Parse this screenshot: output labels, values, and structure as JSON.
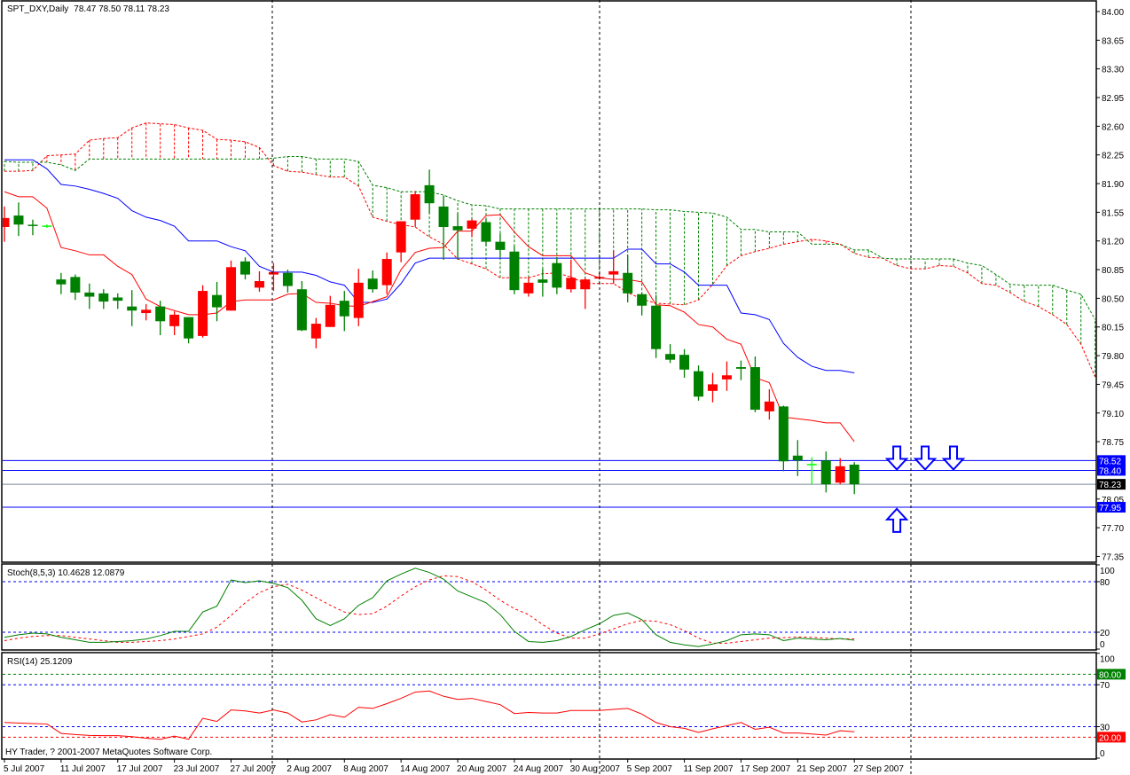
{
  "header": {
    "title": "SPT_DXY,Daily",
    "ohlc": "78.47 78.50 78.11 78.23"
  },
  "footer": {
    "copyright": "HY Trader, ? 2001-2007 MetaQuotes Software Corp."
  },
  "colors": {
    "up": "#ff0000",
    "down": "#008000",
    "doji": "#00ff00",
    "tenkan": "#ff0000",
    "kijun": "#0000ff",
    "span_a": "#ff0000",
    "span_b": "#008000",
    "level": "#0000ff",
    "bid": "#778899",
    "stoch_main": "#008000",
    "stoch_signal": "#ff0000",
    "rsi": "#ff0000"
  },
  "chart_data": [
    {
      "type": "candlestick",
      "title": "SPT_DXY,Daily",
      "ylim": [
        77.28,
        84.14
      ],
      "price_ticks": [
        "84.00",
        "83.65",
        "83.30",
        "82.95",
        "82.60",
        "82.25",
        "81.90",
        "81.55",
        "81.20",
        "80.85",
        "80.50",
        "80.15",
        "79.80",
        "79.45",
        "79.10",
        "78.75",
        "78.05",
        "77.70",
        "77.35"
      ],
      "x_labels": [
        "5 Jul 2007",
        "11 Jul 2007",
        "17 Jul 2007",
        "23 Jul 2007",
        "27 Jul 2007",
        "2 Aug 2007",
        "8 Aug 2007",
        "14 Aug 2007",
        "20 Aug 2007",
        "24 Aug 2007",
        "30 Aug 2007",
        "5 Sep 2007",
        "11 Sep 2007",
        "17 Sep 2007",
        "21 Sep 2007",
        "27 Sep 2007"
      ],
      "x_label_every_bars": 4,
      "ohlc": [
        [
          81.37,
          81.62,
          81.19,
          81.48
        ],
        [
          81.51,
          81.67,
          81.26,
          81.4
        ],
        [
          81.39,
          81.46,
          81.27,
          81.38
        ],
        [
          81.38,
          81.4,
          81.36,
          81.38
        ],
        [
          80.73,
          80.81,
          80.55,
          80.67
        ],
        [
          80.76,
          80.79,
          80.48,
          80.57
        ],
        [
          80.57,
          80.68,
          80.37,
          80.52
        ],
        [
          80.56,
          80.61,
          80.37,
          80.46
        ],
        [
          80.51,
          80.56,
          80.37,
          80.47
        ],
        [
          80.4,
          80.6,
          80.16,
          80.35
        ],
        [
          80.32,
          80.43,
          80.23,
          80.36
        ],
        [
          80.4,
          80.47,
          80.05,
          80.22
        ],
        [
          80.16,
          80.34,
          80.05,
          80.3
        ],
        [
          80.27,
          80.27,
          79.95,
          80.01
        ],
        [
          80.04,
          80.66,
          80.02,
          80.59
        ],
        [
          80.54,
          80.7,
          80.22,
          80.39
        ],
        [
          80.35,
          80.96,
          80.35,
          80.88
        ],
        [
          80.95,
          81.0,
          80.73,
          80.79
        ],
        [
          80.63,
          80.83,
          80.58,
          80.71
        ],
        [
          80.79,
          80.93,
          80.59,
          80.82
        ],
        [
          80.81,
          80.85,
          80.57,
          80.65
        ],
        [
          80.61,
          80.71,
          80.1,
          80.11
        ],
        [
          80.01,
          80.26,
          79.89,
          80.19
        ],
        [
          80.15,
          80.53,
          80.15,
          80.42
        ],
        [
          80.47,
          80.59,
          80.1,
          80.28
        ],
        [
          80.26,
          80.86,
          80.16,
          80.69
        ],
        [
          80.74,
          80.84,
          80.57,
          80.61
        ],
        [
          80.66,
          81.06,
          80.55,
          80.98
        ],
        [
          81.06,
          81.44,
          80.94,
          81.44
        ],
        [
          81.46,
          81.81,
          81.38,
          81.77
        ],
        [
          81.88,
          82.07,
          81.54,
          81.66
        ],
        [
          81.62,
          81.75,
          80.97,
          81.37
        ],
        [
          81.38,
          81.54,
          80.97,
          81.33
        ],
        [
          81.35,
          81.47,
          81.25,
          81.45
        ],
        [
          81.43,
          81.47,
          81.14,
          81.19
        ],
        [
          81.19,
          81.29,
          81.0,
          81.09
        ],
        [
          81.07,
          81.14,
          80.55,
          80.6
        ],
        [
          80.56,
          80.76,
          80.52,
          80.69
        ],
        [
          80.73,
          80.86,
          80.52,
          80.69
        ],
        [
          80.93,
          81.0,
          80.55,
          80.63
        ],
        [
          80.61,
          80.97,
          80.57,
          80.75
        ],
        [
          80.61,
          80.75,
          80.37,
          80.73
        ],
        [
          80.74,
          80.81,
          80.73,
          80.76
        ],
        [
          80.79,
          81.08,
          80.68,
          80.83
        ],
        [
          80.81,
          81.03,
          80.45,
          80.56
        ],
        [
          80.55,
          80.57,
          80.29,
          80.41
        ],
        [
          80.41,
          80.54,
          79.77,
          79.88
        ],
        [
          79.82,
          79.94,
          79.71,
          79.75
        ],
        [
          79.81,
          79.88,
          79.53,
          79.63
        ],
        [
          79.61,
          79.68,
          79.25,
          79.3
        ],
        [
          79.37,
          79.59,
          79.23,
          79.45
        ],
        [
          79.51,
          79.73,
          79.37,
          79.56
        ],
        [
          79.66,
          79.74,
          79.5,
          79.64
        ],
        [
          79.66,
          79.79,
          79.11,
          79.14
        ],
        [
          79.12,
          79.39,
          79.02,
          79.24
        ],
        [
          79.18,
          79.19,
          78.39,
          78.51
        ],
        [
          78.58,
          78.77,
          78.33,
          78.52
        ],
        [
          78.47,
          78.56,
          78.23,
          78.47
        ],
        [
          78.52,
          78.63,
          78.13,
          78.23
        ],
        [
          78.25,
          78.55,
          78.23,
          78.45
        ],
        [
          78.47,
          78.5,
          78.11,
          78.23
        ]
      ],
      "tenkan": [
        81.8,
        81.74,
        81.74,
        81.6,
        81.12,
        81.08,
        81.03,
        81.03,
        80.89,
        80.79,
        80.49,
        80.4,
        80.35,
        80.3,
        80.3,
        80.32,
        80.46,
        80.48,
        80.48,
        80.48,
        80.55,
        80.56,
        80.45,
        80.44,
        80.41,
        80.4,
        80.46,
        80.52,
        80.85,
        81.06,
        81.11,
        81.12,
        81.32,
        81.32,
        81.51,
        81.52,
        81.31,
        81.13,
        81.02,
        81.02,
        81.02,
        80.81,
        80.75,
        80.73,
        80.73,
        80.7,
        80.42,
        80.41,
        80.33,
        80.18,
        80.15,
        80.0,
        79.94,
        79.53,
        79.47,
        79.05,
        79.03,
        79.01,
        78.98,
        78.98,
        78.75
      ],
      "kijun": [
        82.19,
        82.19,
        82.19,
        82.08,
        81.89,
        81.87,
        81.83,
        81.78,
        81.72,
        81.57,
        81.49,
        81.45,
        81.38,
        81.2,
        81.2,
        81.2,
        81.13,
        81.08,
        80.89,
        80.82,
        80.82,
        80.82,
        80.78,
        80.7,
        80.66,
        80.45,
        80.45,
        80.49,
        80.68,
        80.93,
        80.99,
        80.99,
        80.99,
        80.99,
        80.99,
        80.99,
        80.99,
        80.99,
        80.99,
        80.99,
        80.99,
        80.99,
        80.99,
        80.99,
        81.1,
        81.1,
        80.92,
        80.92,
        80.82,
        80.66,
        80.66,
        80.66,
        80.32,
        80.3,
        80.24,
        79.95,
        79.78,
        79.67,
        79.62,
        79.62,
        79.59
      ],
      "senkou_a": [
        82.05,
        82.05,
        82.06,
        82.24,
        82.25,
        82.26,
        82.43,
        82.45,
        82.46,
        82.58,
        82.64,
        82.63,
        82.62,
        82.58,
        82.55,
        82.44,
        82.43,
        82.41,
        82.34,
        82.12,
        82.05,
        82.04,
        82.01,
        81.98,
        81.98,
        81.87,
        81.49,
        81.44,
        81.4,
        81.37,
        81.25,
        81.16,
        80.98,
        80.92,
        80.86,
        80.75,
        80.75,
        80.75,
        80.8,
        80.81,
        80.76,
        80.68,
        80.68,
        80.68,
        80.57,
        80.49,
        80.44,
        80.43,
        80.42,
        80.48,
        80.67,
        80.9,
        81.02,
        81.07,
        81.11,
        81.16,
        81.19,
        81.22,
        81.2,
        81.16,
        81.05,
        81.0,
        80.99,
        80.9,
        80.86,
        80.86,
        80.9,
        80.89,
        80.81,
        80.68,
        80.66,
        80.57,
        80.46,
        80.4,
        80.3,
        80.18,
        79.94,
        79.54
      ],
      "senkou_b": [
        82.17,
        82.16,
        82.16,
        82.16,
        82.13,
        82.06,
        82.2,
        82.2,
        82.2,
        82.2,
        82.2,
        82.2,
        82.2,
        82.2,
        82.2,
        82.2,
        82.2,
        82.2,
        82.2,
        82.21,
        82.23,
        82.23,
        82.2,
        82.2,
        82.2,
        82.17,
        81.88,
        81.85,
        81.8,
        81.8,
        81.8,
        81.76,
        81.69,
        81.64,
        81.63,
        81.59,
        81.59,
        81.59,
        81.59,
        81.59,
        81.59,
        81.59,
        81.59,
        81.59,
        81.59,
        81.59,
        81.58,
        81.58,
        81.56,
        81.55,
        81.54,
        81.49,
        81.34,
        81.34,
        81.31,
        81.31,
        81.31,
        81.16,
        81.16,
        81.16,
        81.09,
        81.09,
        80.99,
        80.98,
        80.98,
        80.98,
        80.98,
        80.98,
        80.93,
        80.9,
        80.79,
        80.67,
        80.66,
        80.66,
        80.66,
        80.6,
        80.55,
        80.24
      ],
      "levels": [
        {
          "price": 78.52,
          "label": "78.52",
          "kind": "level"
        },
        {
          "price": 78.4,
          "label": "78.40",
          "kind": "level"
        },
        {
          "price": 78.23,
          "label": "78.23",
          "kind": "bid"
        },
        {
          "price": 77.95,
          "label": "77.95",
          "kind": "level"
        }
      ],
      "arrows": [
        {
          "direction": "down",
          "bar": 63,
          "price": 78.41
        },
        {
          "direction": "down",
          "bar": 65,
          "price": 78.41
        },
        {
          "direction": "down",
          "bar": 67,
          "price": 78.41
        },
        {
          "direction": "up",
          "bar": 63,
          "price": 77.93
        }
      ]
    },
    {
      "type": "line",
      "title": "Stoch(8,5,3) 10.4628 12.0879",
      "ylim": [
        0,
        100
      ],
      "ticks": [
        "100",
        "80",
        "20",
        "0"
      ],
      "levels": [
        80,
        20
      ],
      "series": [
        {
          "name": "main",
          "values": [
            14,
            17,
            19,
            18,
            14,
            11,
            8,
            8,
            9,
            10,
            12,
            16,
            21,
            21,
            44,
            51,
            82,
            79,
            81,
            78,
            73,
            58,
            36,
            28,
            36,
            52,
            61,
            81,
            89,
            96,
            91,
            83,
            69,
            62,
            55,
            41,
            21,
            9,
            8,
            10,
            15,
            23,
            30,
            40,
            43,
            35,
            17,
            8,
            5,
            3,
            6,
            10,
            17,
            18,
            17,
            10,
            13,
            12,
            11,
            12.6,
            10.46
          ]
        },
        {
          "name": "signal",
          "values": [
            10,
            13,
            15,
            16,
            16,
            14,
            12,
            10,
            8,
            8,
            9,
            10,
            12,
            15,
            18,
            26,
            40,
            55,
            67,
            74,
            77,
            70,
            61,
            52,
            44,
            41,
            42,
            51,
            63,
            74,
            82,
            87,
            86,
            80,
            70,
            58,
            48,
            41,
            29,
            19,
            13,
            13,
            18,
            24,
            30,
            34,
            33,
            29,
            22,
            13,
            7,
            7,
            9,
            11,
            13,
            13.5,
            14.5,
            14,
            13,
            12,
            12.09
          ]
        }
      ]
    },
    {
      "type": "line",
      "title": "RSI(14) 25.1209",
      "ylim": [
        0,
        100
      ],
      "ticks": [
        "100",
        "70",
        "30",
        "0"
      ],
      "boxed_levels": [
        {
          "value": 80,
          "label": "80.00",
          "color": "#008000"
        },
        {
          "value": 20,
          "label": "20.00",
          "color": "#ff0000"
        }
      ],
      "levels": [
        {
          "value": 70,
          "color": "#0000ff"
        },
        {
          "value": 30,
          "color": "#0000ff"
        }
      ],
      "series": [
        {
          "name": "rsi",
          "values": [
            34,
            33.5,
            33,
            32.6,
            23.6,
            22.5,
            21.7,
            21.5,
            21.4,
            20.5,
            19,
            18,
            21,
            18,
            38,
            35,
            46,
            45,
            43,
            46,
            43,
            34.5,
            36.5,
            41.5,
            39,
            48.5,
            47.4,
            52,
            57,
            63,
            64,
            59,
            56,
            57,
            54,
            51,
            42.5,
            43.5,
            43,
            43,
            45.4,
            45.4,
            45.4,
            46.5,
            47.4,
            42,
            34,
            30,
            28.4,
            24.5,
            28,
            31,
            34,
            27.5,
            29.5,
            24,
            24,
            23,
            22,
            26.2,
            25.12
          ]
        }
      ]
    }
  ]
}
